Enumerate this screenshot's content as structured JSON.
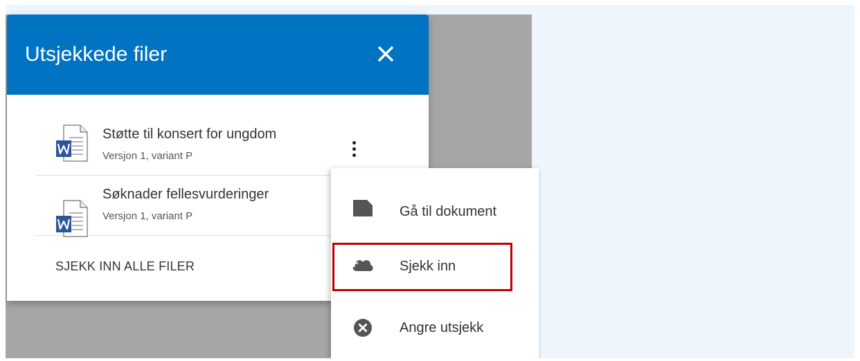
{
  "dialog": {
    "title": "Utsjekkede filer",
    "close_icon": "close-icon",
    "files": [
      {
        "name": "Støtte til konsert for ungdom",
        "meta": "Versjon 1, variant P",
        "icon": "word-file-icon"
      },
      {
        "name": "Søknader fellesvurderinger",
        "meta": "Versjon 1, variant P",
        "icon": "word-file-icon"
      }
    ],
    "checkin_all_label": "SJEKK INN ALLE FILER"
  },
  "context_menu": {
    "items": [
      {
        "label": "Gå til dokument",
        "icon": "document-icon"
      },
      {
        "label": "Sjekk inn",
        "icon": "cloud-upload-icon",
        "highlighted": true
      },
      {
        "label": "Angre utsjekk",
        "icon": "cancel-circle-icon"
      }
    ]
  },
  "colors": {
    "header_blue": "#0073c2",
    "highlight_red": "#c00000",
    "word_blue": "#2b579a"
  }
}
